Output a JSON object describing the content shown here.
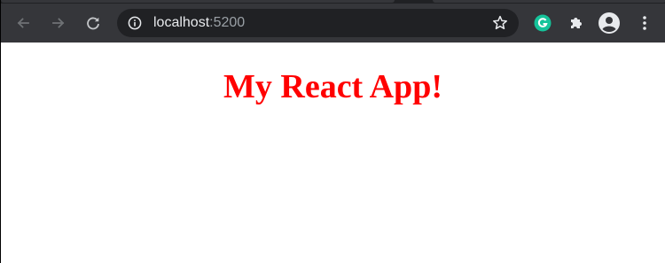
{
  "browser": {
    "address_bar": {
      "host": "localhost",
      "port": ":5200",
      "security_icon": "info-icon",
      "bookmark_icon": "star-icon"
    },
    "navigation": {
      "back_icon": "back-arrow-icon",
      "forward_icon": "forward-arrow-icon",
      "reload_icon": "reload-icon"
    },
    "extensions": {
      "grammarly_icon": "grammarly-icon",
      "extensions_icon": "puzzle-icon",
      "profile_icon": "profile-avatar-icon",
      "menu_icon": "kebab-menu-icon"
    },
    "colors": {
      "toolbar": "#35363a",
      "omnibox": "#202124",
      "grammarly": "#15c39a"
    }
  },
  "page": {
    "title": "My React App!",
    "title_color": "#ff0000",
    "background": "#ffffff"
  }
}
